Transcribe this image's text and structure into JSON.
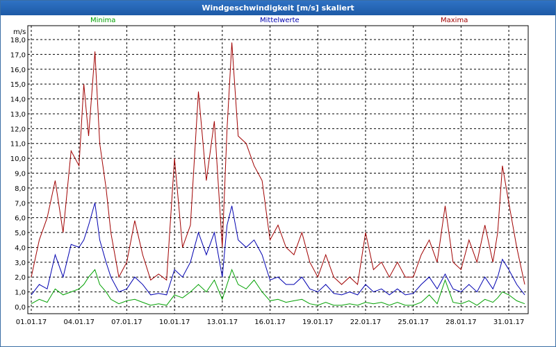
{
  "window": {
    "title": "Windgeschwindigkeit [m/s] skaliert"
  },
  "legend": [
    {
      "label": "Minima",
      "color": "#00a000"
    },
    {
      "label": "Mittelwerte",
      "color": "#0000b0"
    },
    {
      "label": "Maxima",
      "color": "#a00000"
    }
  ],
  "chart_data": {
    "type": "line",
    "title": "Windgeschwindigkeit [m/s] skaliert",
    "ylabel": "m/s",
    "ylim": [
      0,
      18
    ],
    "yticks": [
      "0,0",
      "1,0",
      "2,0",
      "3,0",
      "4,0",
      "5,0",
      "6,0",
      "7,0",
      "8,0",
      "9,0",
      "10,0",
      "11,0",
      "12,0",
      "13,0",
      "14,0",
      "15,0",
      "16,0",
      "17,0",
      "18,0"
    ],
    "xlim": [
      0,
      31
    ],
    "xticks": [
      {
        "label": "01.01.17",
        "day": 0
      },
      {
        "label": "04.01.17",
        "day": 3
      },
      {
        "label": "07.01.17",
        "day": 6
      },
      {
        "label": "10.01.17",
        "day": 9
      },
      {
        "label": "13.01.17",
        "day": 12
      },
      {
        "label": "16.01.17",
        "day": 15
      },
      {
        "label": "19.01.17",
        "day": 18
      },
      {
        "label": "22.01.17",
        "day": 21
      },
      {
        "label": "25.01.17",
        "day": 24
      },
      {
        "label": "28.01.17",
        "day": 27
      },
      {
        "label": "31.01.17",
        "day": 30
      }
    ],
    "grid": true,
    "legend_position": "top",
    "series": [
      {
        "name": "Maxima",
        "color": "#a00000",
        "x": [
          0,
          0.5,
          1,
          1.5,
          2,
          2.5,
          3,
          3.3,
          3.6,
          4,
          4.3,
          4.7,
          5,
          5.5,
          6,
          6.5,
          7,
          7.5,
          8,
          8.5,
          9,
          9.5,
          10,
          10.5,
          11,
          11.5,
          12,
          12.3,
          12.6,
          13,
          13.5,
          14,
          14.5,
          15,
          15.5,
          16,
          16.5,
          17,
          17.5,
          18,
          18.5,
          19,
          19.5,
          20,
          20.5,
          21,
          21.5,
          22,
          22.5,
          23,
          23.5,
          24,
          24.5,
          25,
          25.5,
          26,
          26.5,
          27,
          27.5,
          28,
          28.5,
          29,
          29.3,
          29.6,
          30,
          30.5,
          31
        ],
        "values": [
          2.0,
          4.5,
          6.0,
          8.5,
          5.0,
          10.5,
          9.5,
          15.0,
          11.5,
          17.2,
          11.0,
          8.0,
          5.0,
          2.0,
          3.0,
          5.8,
          3.5,
          1.8,
          2.2,
          1.8,
          10.0,
          4.0,
          5.5,
          14.5,
          8.5,
          12.5,
          4.0,
          12.0,
          17.8,
          11.5,
          11.0,
          9.5,
          8.5,
          4.5,
          5.5,
          4.0,
          3.5,
          5.0,
          3.0,
          2.0,
          3.5,
          2.0,
          1.5,
          2.0,
          1.5,
          5.0,
          2.5,
          3.0,
          2.0,
          3.0,
          2.0,
          2.0,
          3.5,
          4.5,
          3.0,
          6.8,
          3.0,
          2.5,
          4.5,
          3.0,
          5.5,
          3.0,
          5.0,
          9.5,
          7.0,
          4.0,
          1.5
        ]
      },
      {
        "name": "Mittelwerte",
        "color": "#0000b0",
        "x": [
          0,
          0.5,
          1,
          1.5,
          2,
          2.5,
          3,
          3.3,
          3.6,
          4,
          4.3,
          4.7,
          5,
          5.5,
          6,
          6.5,
          7,
          7.5,
          8,
          8.5,
          9,
          9.5,
          10,
          10.5,
          11,
          11.5,
          12,
          12.3,
          12.6,
          13,
          13.5,
          14,
          14.5,
          15,
          15.5,
          16,
          16.5,
          17,
          17.5,
          18,
          18.5,
          19,
          19.5,
          20,
          20.5,
          21,
          21.5,
          22,
          22.5,
          23,
          23.5,
          24,
          24.5,
          25,
          25.5,
          26,
          26.5,
          27,
          27.5,
          28,
          28.5,
          29,
          29.3,
          29.6,
          30,
          30.5,
          31
        ],
        "values": [
          0.8,
          1.5,
          1.2,
          3.5,
          2.0,
          4.2,
          4.0,
          4.5,
          5.5,
          7.0,
          4.5,
          3.0,
          2.0,
          1.0,
          1.2,
          2.0,
          1.5,
          0.8,
          0.9,
          0.8,
          2.5,
          2.0,
          3.0,
          5.0,
          3.5,
          5.0,
          2.0,
          5.5,
          6.8,
          4.5,
          4.0,
          4.5,
          3.5,
          1.8,
          2.0,
          1.5,
          1.5,
          2.0,
          1.2,
          1.0,
          1.5,
          0.9,
          0.8,
          1.0,
          0.8,
          1.5,
          1.0,
          1.2,
          0.8,
          1.2,
          0.8,
          0.9,
          1.5,
          2.0,
          1.2,
          2.2,
          1.2,
          1.0,
          1.5,
          1.0,
          2.0,
          1.2,
          2.0,
          3.2,
          2.5,
          1.5,
          0.8
        ]
      },
      {
        "name": "Minima",
        "color": "#00a000",
        "x": [
          0,
          0.5,
          1,
          1.5,
          2,
          2.5,
          3,
          3.3,
          3.6,
          4,
          4.3,
          4.7,
          5,
          5.5,
          6,
          6.5,
          7,
          7.5,
          8,
          8.5,
          9,
          9.5,
          10,
          10.5,
          11,
          11.5,
          12,
          12.3,
          12.6,
          13,
          13.5,
          14,
          14.5,
          15,
          15.5,
          16,
          16.5,
          17,
          17.5,
          18,
          18.5,
          19,
          19.5,
          20,
          20.5,
          21,
          21.5,
          22,
          22.5,
          23,
          23.5,
          24,
          24.5,
          25,
          25.5,
          26,
          26.5,
          27,
          27.5,
          28,
          28.5,
          29,
          29.3,
          29.6,
          30,
          30.5,
          31
        ],
        "values": [
          0.2,
          0.5,
          0.3,
          1.2,
          0.8,
          1.0,
          1.2,
          1.5,
          2.0,
          2.5,
          1.5,
          1.0,
          0.5,
          0.2,
          0.4,
          0.5,
          0.3,
          0.1,
          0.2,
          0.1,
          0.8,
          0.6,
          1.0,
          1.5,
          1.0,
          1.8,
          0.5,
          1.5,
          2.5,
          1.5,
          1.2,
          1.8,
          1.0,
          0.4,
          0.5,
          0.3,
          0.4,
          0.5,
          0.2,
          0.1,
          0.3,
          0.1,
          0.1,
          0.2,
          0.1,
          0.3,
          0.2,
          0.3,
          0.1,
          0.3,
          0.1,
          0.1,
          0.3,
          0.8,
          0.2,
          1.8,
          0.3,
          0.2,
          0.4,
          0.1,
          0.5,
          0.3,
          0.6,
          1.0,
          0.8,
          0.4,
          0.2
        ]
      }
    ]
  }
}
